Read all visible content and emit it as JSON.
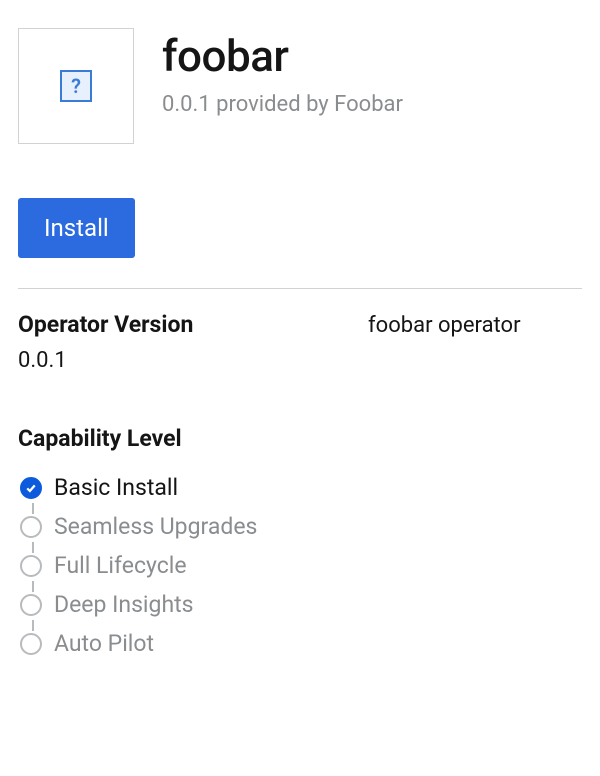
{
  "header": {
    "title": "foobar",
    "subtitle": "0.0.1 provided by Foobar",
    "icon_glyph": "?"
  },
  "actions": {
    "install_label": "Install"
  },
  "details": {
    "version_heading": "Operator Version",
    "version_value": "0.0.1",
    "description": "foobar operator"
  },
  "capability": {
    "heading": "Capability Level",
    "levels": [
      {
        "label": "Basic Install",
        "achieved": true
      },
      {
        "label": "Seamless Upgrades",
        "achieved": false
      },
      {
        "label": "Full Lifecycle",
        "achieved": false
      },
      {
        "label": "Deep Insights",
        "achieved": false
      },
      {
        "label": "Auto Pilot",
        "achieved": false
      }
    ]
  }
}
